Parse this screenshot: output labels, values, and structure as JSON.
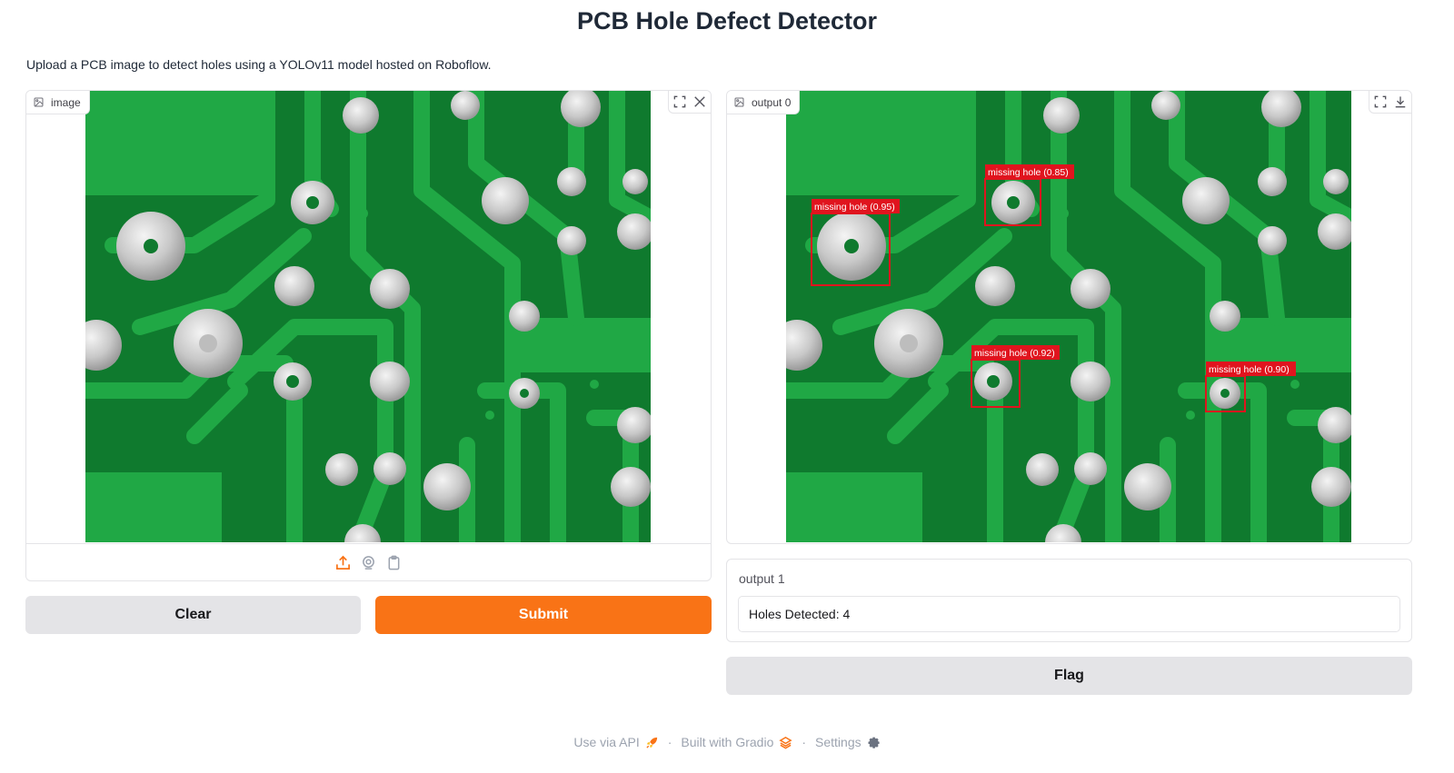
{
  "header": {
    "title": "PCB Hole Defect Detector",
    "description": "Upload a PCB image to detect holes using a YOLOv11 model hosted on Roboflow."
  },
  "input_panel": {
    "label": "image",
    "icons": [
      "image-icon",
      "fullscreen-icon",
      "close-icon",
      "upload-icon",
      "webcam-icon",
      "clipboard-icon"
    ]
  },
  "output_panel": {
    "label": "output 0",
    "icons": [
      "image-icon",
      "fullscreen-icon",
      "download-icon"
    ],
    "detections": [
      {
        "label": "missing hole (0.95)"
      },
      {
        "label": "missing hole (0.85)"
      },
      {
        "label": "missing hole (0.92)"
      },
      {
        "label": "missing hole (0.90)"
      }
    ]
  },
  "buttons": {
    "clear": "Clear",
    "submit": "Submit",
    "flag": "Flag"
  },
  "output_text": {
    "label": "output 1",
    "value": "Holes Detected: 4"
  },
  "footer": {
    "api": "Use via API",
    "built": "Built with Gradio",
    "settings": "Settings",
    "separator": "·"
  },
  "colors": {
    "accent": "#f97316",
    "pcb_dark": "#0f7a2e",
    "pcb_light": "#20a845",
    "detection_box": "#e0141e"
  }
}
